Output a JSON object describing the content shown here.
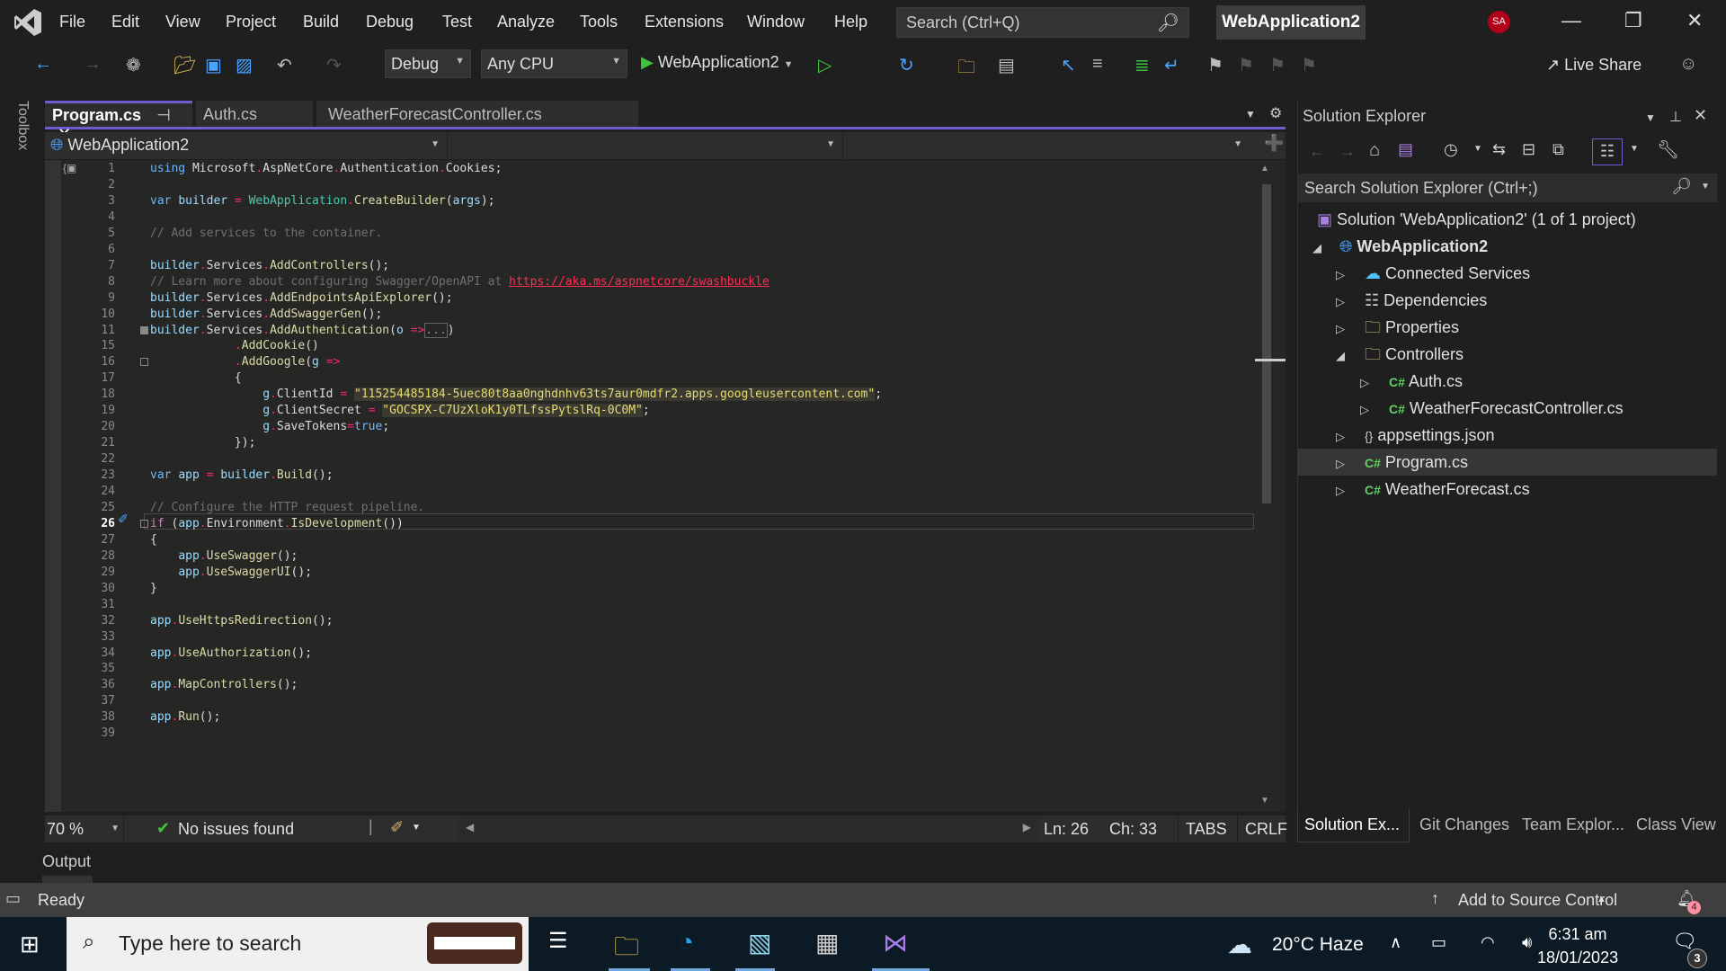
{
  "app": {
    "menu": [
      "File",
      "Edit",
      "View",
      "Project",
      "Build",
      "Debug",
      "Test",
      "Analyze",
      "Tools",
      "Extensions",
      "Window",
      "Help"
    ],
    "search_placeholder": "Search (Ctrl+Q)",
    "solution_name": "WebApplication2",
    "user_initials": "SA",
    "accent": "#6f5cd1"
  },
  "toolbar": {
    "configuration": "Debug",
    "platform": "Any CPU",
    "run_target": "WebApplication2",
    "live_share": "Live Share"
  },
  "toolbox_label": "Toolbox",
  "editor": {
    "tabs": [
      {
        "label": "Program.cs",
        "active": true
      },
      {
        "label": "Auth.cs",
        "active": false
      },
      {
        "label": "WeatherForecastController.cs",
        "active": false
      }
    ],
    "nav_project": "WebApplication2",
    "lines": [
      {
        "n": "1",
        "code": "using Microsoft.AspNetCore.Authentication.Cookies;"
      },
      {
        "n": "2",
        "code": ""
      },
      {
        "n": "3",
        "code": "var builder = WebApplication.CreateBuilder(args);"
      },
      {
        "n": "4",
        "code": ""
      },
      {
        "n": "5",
        "code": "// Add services to the container."
      },
      {
        "n": "6",
        "code": ""
      },
      {
        "n": "7",
        "code": "builder.Services.AddControllers();"
      },
      {
        "n": "8",
        "code": "// Learn more about configuring Swagger/OpenAPI at ",
        "link": "https://aka.ms/aspnetcore/swashbuckle"
      },
      {
        "n": "9",
        "code": "builder.Services.AddEndpointsApiExplorer();"
      },
      {
        "n": "10",
        "code": "builder.Services.AddSwaggerGen();"
      },
      {
        "n": "11",
        "code": "builder.Services.AddAuthentication(o =>[...])"
      },
      {
        "n": "15",
        "code": "            .AddCookie()"
      },
      {
        "n": "16",
        "code": "            .AddGoogle(g =>"
      },
      {
        "n": "17",
        "code": "            {"
      },
      {
        "n": "18",
        "code": "                g.ClientId = \"115254485184-5uec80t8aa0nghdnhv63ts7aur0mdfr2.apps.googleusercontent.com\";"
      },
      {
        "n": "19",
        "code": "                g.ClientSecret = \"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\";"
      },
      {
        "n": "20",
        "code": "                g.SaveTokens=true;"
      },
      {
        "n": "21",
        "code": "            });"
      },
      {
        "n": "22",
        "code": ""
      },
      {
        "n": "23",
        "code": "var app = builder.Build();"
      },
      {
        "n": "24",
        "code": ""
      },
      {
        "n": "25",
        "code": "// Configure the HTTP request pipeline."
      },
      {
        "n": "26",
        "code": "if (app.Environment.IsDevelopment())"
      },
      {
        "n": "27",
        "code": "{"
      },
      {
        "n": "28",
        "code": "    app.UseSwagger();"
      },
      {
        "n": "29",
        "code": "    app.UseSwaggerUI();"
      },
      {
        "n": "30",
        "code": "}"
      },
      {
        "n": "31",
        "code": ""
      },
      {
        "n": "32",
        "code": "app.UseHttpsRedirection();"
      },
      {
        "n": "33",
        "code": ""
      },
      {
        "n": "34",
        "code": "app.UseAuthorization();"
      },
      {
        "n": "35",
        "code": ""
      },
      {
        "n": "36",
        "code": "app.MapControllers();"
      },
      {
        "n": "37",
        "code": ""
      },
      {
        "n": "38",
        "code": "app.Run();"
      },
      {
        "n": "39",
        "code": ""
      }
    ],
    "status": {
      "zoom": "70 %",
      "issues": "No issues found",
      "line": "Ln: 26",
      "col": "Ch: 33",
      "indent": "TABS",
      "eol": "CRLF"
    }
  },
  "solution_explorer": {
    "title": "Solution Explorer",
    "search_placeholder": "Search Solution Explorer (Ctrl+;)",
    "items": [
      {
        "label": "Solution 'WebApplication2' (1 of 1 project)",
        "icon": "solution-icon"
      },
      {
        "label": "WebApplication2",
        "icon": "web-project-icon",
        "expanded": true
      },
      {
        "label": "Connected Services",
        "icon": "connected-services-icon"
      },
      {
        "label": "Dependencies",
        "icon": "dependencies-icon"
      },
      {
        "label": "Properties",
        "icon": "properties-folder-icon"
      },
      {
        "label": "Controllers",
        "icon": "folder-icon",
        "expanded": true
      },
      {
        "label": "Auth.cs",
        "icon": "csharp-file-icon"
      },
      {
        "label": "WeatherForecastController.cs",
        "icon": "csharp-file-icon"
      },
      {
        "label": "appsettings.json",
        "icon": "json-file-icon"
      },
      {
        "label": "Program.cs",
        "icon": "csharp-file-icon",
        "selected": true
      },
      {
        "label": "WeatherForecast.cs",
        "icon": "csharp-file-icon"
      }
    ],
    "csharp_glyph": "C#",
    "bottom_tabs": [
      "Solution Ex...",
      "Git Changes",
      "Team Explor...",
      "Class View"
    ]
  },
  "output_label": "Output",
  "statusbar": {
    "ready": "Ready",
    "source_control": "Add to Source Control",
    "notifications": "4"
  },
  "taskbar": {
    "search_placeholder": "Type here to search",
    "weather": "20°C  Haze",
    "time": "6:31 am",
    "date": "18/01/2023",
    "action_center_count": "3"
  }
}
